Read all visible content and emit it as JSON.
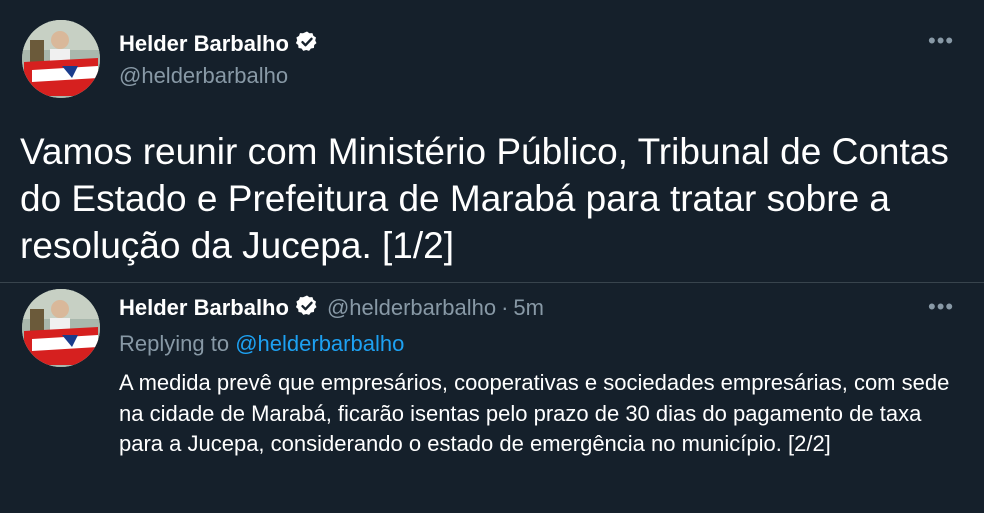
{
  "main_tweet": {
    "author_name": "Helder Barbalho",
    "author_handle": "@helderbarbalho",
    "text": "Vamos reunir com Ministério Público, Tribunal de Contas do Estado e Prefeitura de Marabá para tratar sobre a resolução da Jucepa. [1/2]",
    "more_icon": "more-horizontal-icon",
    "verified_icon": "verified-badge-icon"
  },
  "reply_tweet": {
    "author_name": "Helder Barbalho",
    "author_handle": "@helderbarbalho",
    "separator": "·",
    "time": "5m",
    "replying_prefix": "Replying to",
    "replying_to": "@helderbarbalho",
    "text": "A medida  prevê que empresários, cooperativas e sociedades empresárias, com sede na cidade de Marabá, ficarão isentas pelo prazo de 30 dias do pagamento de taxa para a Jucepa, considerando o estado de emergência no município. [2/2]",
    "more_icon": "more-horizontal-icon"
  },
  "colors": {
    "background": "#15202b",
    "text": "#ffffff",
    "secondary": "#8899a6",
    "link": "#1da1f2"
  }
}
